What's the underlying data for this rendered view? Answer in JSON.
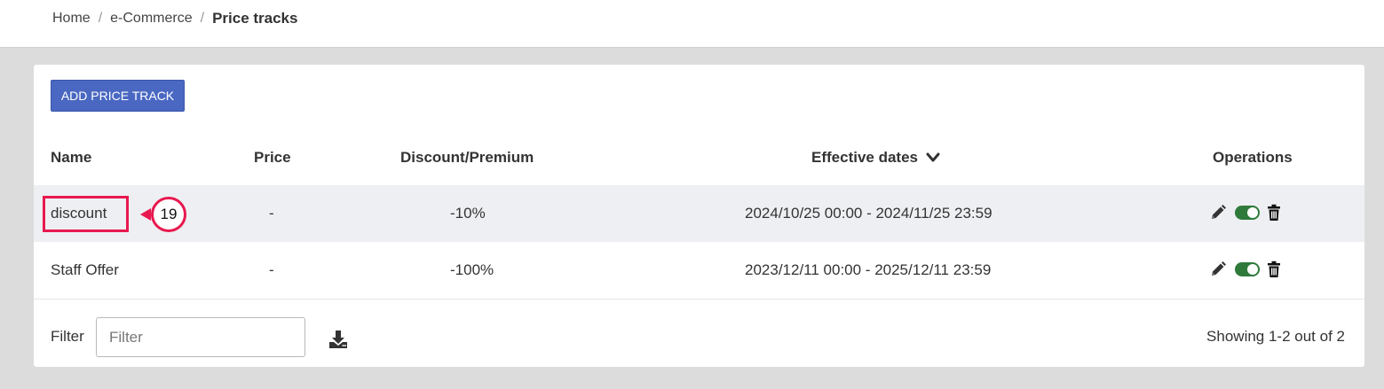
{
  "breadcrumb": {
    "home": "Home",
    "section": "e-Commerce",
    "current": "Price tracks",
    "separator": "/"
  },
  "toolbar": {
    "add_label": "ADD PRICE TRACK"
  },
  "table": {
    "columns": {
      "name": "Name",
      "price": "Price",
      "discount": "Discount/Premium",
      "dates": "Effective dates",
      "operations": "Operations"
    },
    "sort_icon": "chevron-down-icon",
    "rows": [
      {
        "name": "discount",
        "price": "-",
        "discount": "-10%",
        "dates": "2024/10/25 00:00 - 2024/11/25 23:59",
        "enabled": true
      },
      {
        "name": "Staff Offer",
        "price": "-",
        "discount": "-100%",
        "dates": "2023/12/11 00:00 - 2025/12/11 23:59",
        "enabled": true
      }
    ]
  },
  "annotation": {
    "marker_number": "19",
    "color": "#e8194f"
  },
  "footer": {
    "filter_label": "Filter",
    "filter_placeholder": "Filter",
    "filter_value": "",
    "download_icon": "download-icon",
    "showing": "Showing 1-2 out of 2"
  },
  "colors": {
    "primary_button": "#4a68c2",
    "toggle_on": "#2f7a3b",
    "row_highlight": "#eeeff2",
    "page_background": "#dcdcdc"
  }
}
